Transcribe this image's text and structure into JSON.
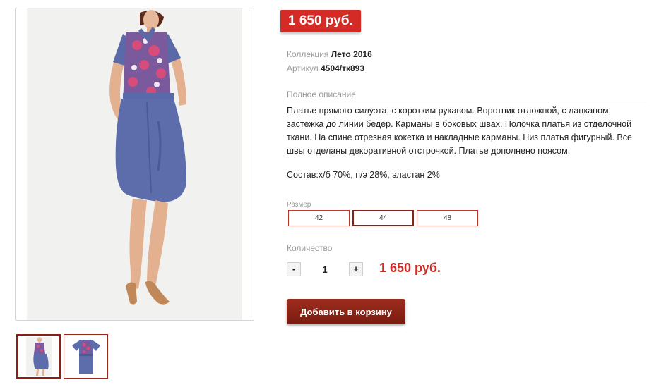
{
  "gallery": {
    "main_image": "woman-in-blue-floral-dress-photo",
    "thumbnails": [
      {
        "image": "dress-model-thumbnail",
        "active": true
      },
      {
        "image": "dress-front-thumbnail",
        "active": false
      }
    ]
  },
  "product": {
    "price_badge": "1 650 руб.",
    "collection_label": "Коллекция",
    "collection_value": "Лето 2016",
    "article_label": "Артикул",
    "article_value": "4504/тк893",
    "description_title": "Полное описание",
    "description": "Платье прямого силуэта, с коротким рукавом. Воротник отложной, с лацканом, застежка до линии бедер. Карманы в боковых швах. Полочка платья из отделочной ткани. На спине отрезная кокетка и накладные карманы. Низ платья фигурный. Все швы отделаны декоративной отстрочкой. Платье дополнено поясом.",
    "composition": "Состав:х/б 70%, п/э 28%, эластан 2%"
  },
  "size": {
    "label": "Размер",
    "options": [
      "42",
      "44",
      "48"
    ],
    "selected": "44"
  },
  "quantity": {
    "label": "Количество",
    "minus": "-",
    "value": "1",
    "plus": "+"
  },
  "total_price": "1 650 руб.",
  "cart": {
    "add_label": "Добавить в корзину"
  },
  "colors": {
    "accent_red": "#d52b26",
    "button_dark_red": "#8a2218",
    "dress_blue": "#5a6aa8"
  }
}
